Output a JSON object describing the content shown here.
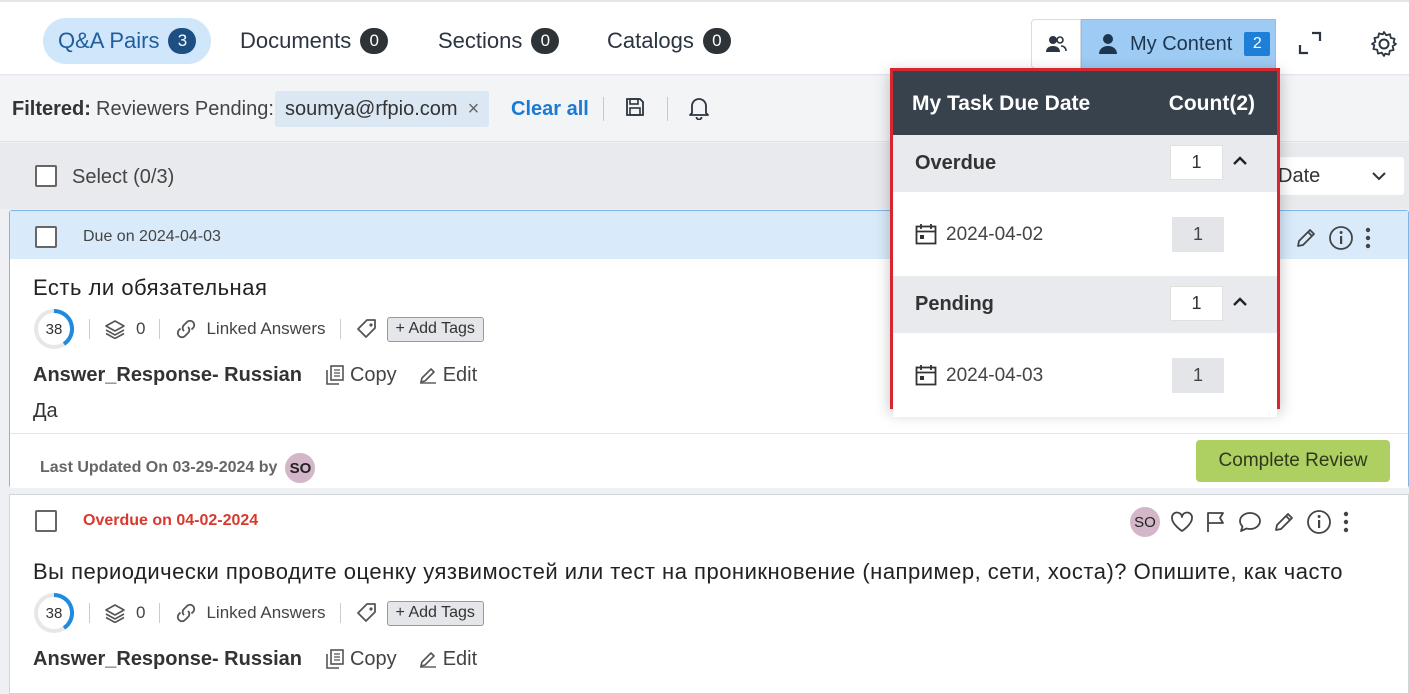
{
  "tabs": [
    {
      "label": "Q&A Pairs",
      "count": "3"
    },
    {
      "label": "Documents",
      "count": "0"
    },
    {
      "label": "Sections",
      "count": "0"
    },
    {
      "label": "Catalogs",
      "count": "0"
    }
  ],
  "header": {
    "my_content_label": "My Content",
    "my_content_count": "2"
  },
  "filter": {
    "label": "Filtered:",
    "field": "Reviewers Pending:",
    "chip_value": "soumya@rfpio.com",
    "chip_remove": "×",
    "clear_all": "Clear all"
  },
  "select_row": {
    "select_label": "Select (0/3)",
    "sort_value": "Date"
  },
  "cards": [
    {
      "due_text": "Due on 2024-04-03",
      "title": "Есть ли обязательная",
      "score": "38",
      "stack_count": "0",
      "linked_answers": "Linked Answers",
      "add_tags": "+ Add Tags",
      "answer_name": "Answer_Response- Russian",
      "copy": "Copy",
      "edit": "Edit",
      "answer_text": "Да",
      "last_updated": "Last Updated On 03-29-2024 by",
      "avatar": "SO",
      "complete_review": "Complete Review"
    },
    {
      "due_text": "Overdue on 04-02-2024",
      "title": "Вы периодически проводите оценку уязвимостей или тест на проникновение (например, сети, хоста)? Опишите, как часто",
      "score": "38",
      "stack_count": "0",
      "linked_answers": "Linked Answers",
      "add_tags": "+ Add Tags",
      "answer_name": "Answer_Response- Russian",
      "copy": "Copy",
      "edit": "Edit",
      "avatar": "SO"
    }
  ],
  "popover": {
    "title": "My Task Due Date",
    "count_label": "Count(2)",
    "groups": [
      {
        "label": "Overdue",
        "count": "1",
        "items": [
          {
            "date": "2024-04-02",
            "count": "1"
          }
        ]
      },
      {
        "label": "Pending",
        "count": "1",
        "items": [
          {
            "date": "2024-04-03",
            "count": "1"
          }
        ]
      }
    ]
  },
  "colors": {
    "accent": "#1a7ad6",
    "popover_header": "#37424d",
    "highlight_border": "#d6262f",
    "complete_btn": "#aecf61",
    "overdue": "#d8382d"
  }
}
